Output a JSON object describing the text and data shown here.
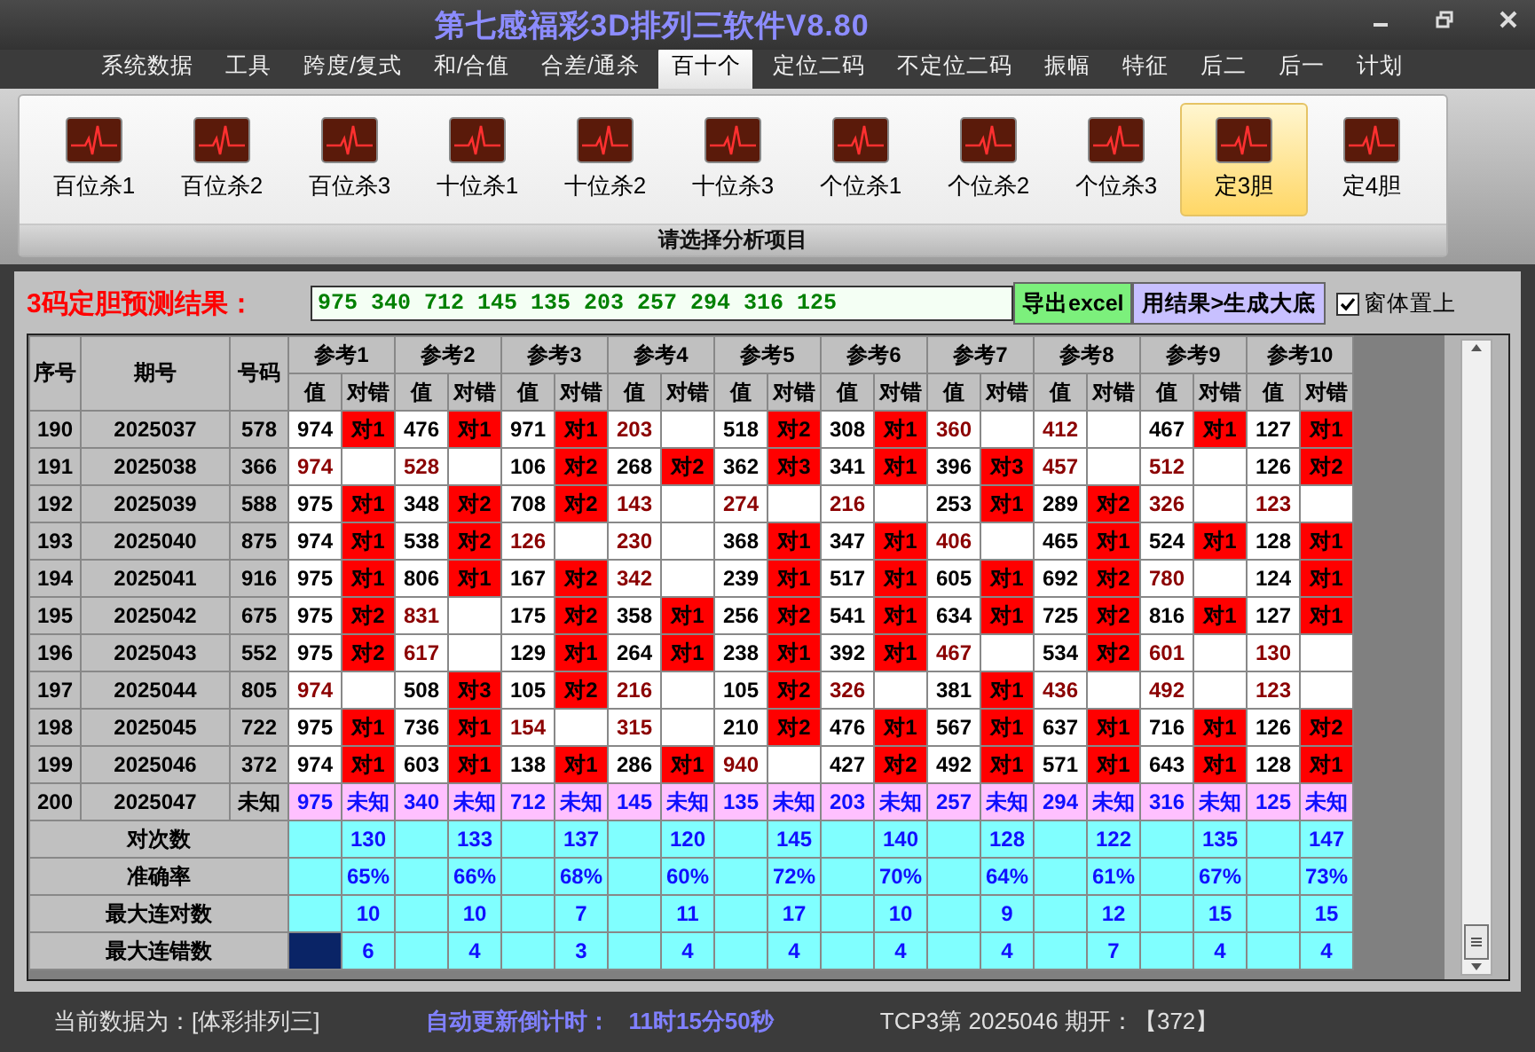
{
  "window": {
    "title": "第七感福彩3D排列三软件V8.80"
  },
  "menu": [
    {
      "label": "系统数据",
      "selected": false
    },
    {
      "label": "工具",
      "selected": false
    },
    {
      "label": "跨度/复式",
      "selected": false
    },
    {
      "label": "和/合值",
      "selected": false
    },
    {
      "label": "合差/通杀",
      "selected": false
    },
    {
      "label": "百十个",
      "selected": true
    },
    {
      "label": "定位二码",
      "selected": false
    },
    {
      "label": "不定位二码",
      "selected": false
    },
    {
      "label": "振幅",
      "selected": false
    },
    {
      "label": "特征",
      "selected": false
    },
    {
      "label": "后二",
      "selected": false
    },
    {
      "label": "后一",
      "selected": false
    },
    {
      "label": "计划",
      "selected": false
    }
  ],
  "ribbon": {
    "caption": "请选择分析项目",
    "items": [
      {
        "label": "百位杀1",
        "selected": false
      },
      {
        "label": "百位杀2",
        "selected": false
      },
      {
        "label": "百位杀3",
        "selected": false
      },
      {
        "label": "十位杀1",
        "selected": false
      },
      {
        "label": "十位杀2",
        "selected": false
      },
      {
        "label": "十位杀3",
        "selected": false
      },
      {
        "label": "个位杀1",
        "selected": false
      },
      {
        "label": "个位杀2",
        "selected": false
      },
      {
        "label": "个位杀3",
        "selected": false
      },
      {
        "label": "定3胆",
        "selected": true
      },
      {
        "label": "定4胆",
        "selected": false
      }
    ]
  },
  "prediction": {
    "label": "3码定胆预测结果：",
    "value": "975 340 712 145 135 203 257 294 316 125",
    "buttons": [
      "导出excel",
      "用结果>生成大底"
    ],
    "topmost": {
      "label": "窗体置上",
      "checked": true
    }
  },
  "table": {
    "columns": [
      "序号",
      "期号",
      "号码"
    ],
    "ref_groups": [
      {
        "label": "参考1",
        "sub_columns": [
          "值",
          "对错"
        ]
      },
      {
        "label": "参考2",
        "sub_columns": [
          "值",
          "对错"
        ]
      },
      {
        "label": "参考3",
        "sub_columns": [
          "值",
          "对错"
        ]
      },
      {
        "label": "参考4",
        "sub_columns": [
          "值",
          "对错"
        ]
      },
      {
        "label": "参考5",
        "sub_columns": [
          "值",
          "对错"
        ]
      },
      {
        "label": "参考6",
        "sub_columns": [
          "值",
          "对错"
        ]
      },
      {
        "label": "参考7",
        "sub_columns": [
          "值",
          "对错"
        ]
      },
      {
        "label": "参考8",
        "sub_columns": [
          "值",
          "对错"
        ]
      },
      {
        "label": "参考9",
        "sub_columns": [
          "值",
          "对错"
        ]
      },
      {
        "label": "参考10",
        "sub_columns": [
          "值",
          "对错"
        ]
      }
    ],
    "rows": [
      {
        "seq": "190",
        "period": "2025037",
        "number": "578",
        "kind": "history",
        "refs": [
          {
            "value": "974",
            "result": "对1"
          },
          {
            "value": "476",
            "result": "对1"
          },
          {
            "value": "971",
            "result": "对1"
          },
          {
            "value": "203"
          },
          {
            "value": "518",
            "result": "对2"
          },
          {
            "value": "308",
            "result": "对1"
          },
          {
            "value": "360"
          },
          {
            "value": "412"
          },
          {
            "value": "467",
            "result": "对1"
          },
          {
            "value": "127",
            "result": "对1"
          }
        ]
      },
      {
        "seq": "191",
        "period": "2025038",
        "number": "366",
        "kind": "history",
        "refs": [
          {
            "value": "974"
          },
          {
            "value": "528"
          },
          {
            "value": "106",
            "result": "对2"
          },
          {
            "value": "268",
            "result": "对2"
          },
          {
            "value": "362",
            "result": "对3"
          },
          {
            "value": "341",
            "result": "对1"
          },
          {
            "value": "396",
            "result": "对3"
          },
          {
            "value": "457"
          },
          {
            "value": "512"
          },
          {
            "value": "126",
            "result": "对2"
          }
        ]
      },
      {
        "seq": "192",
        "period": "2025039",
        "number": "588",
        "kind": "history",
        "refs": [
          {
            "value": "975",
            "result": "对1"
          },
          {
            "value": "348",
            "result": "对2"
          },
          {
            "value": "708",
            "result": "对2"
          },
          {
            "value": "143"
          },
          {
            "value": "274"
          },
          {
            "value": "216"
          },
          {
            "value": "253",
            "result": "对1"
          },
          {
            "value": "289",
            "result": "对2"
          },
          {
            "value": "326"
          },
          {
            "value": "123"
          }
        ]
      },
      {
        "seq": "193",
        "period": "2025040",
        "number": "875",
        "kind": "history",
        "refs": [
          {
            "value": "974",
            "result": "对1"
          },
          {
            "value": "538",
            "result": "对2"
          },
          {
            "value": "126"
          },
          {
            "value": "230"
          },
          {
            "value": "368",
            "result": "对1"
          },
          {
            "value": "347",
            "result": "对1"
          },
          {
            "value": "406"
          },
          {
            "value": "465",
            "result": "对1"
          },
          {
            "value": "524",
            "result": "对1"
          },
          {
            "value": "128",
            "result": "对1"
          }
        ]
      },
      {
        "seq": "194",
        "period": "2025041",
        "number": "916",
        "kind": "history",
        "refs": [
          {
            "value": "975",
            "result": "对1"
          },
          {
            "value": "806",
            "result": "对1"
          },
          {
            "value": "167",
            "result": "对2"
          },
          {
            "value": "342"
          },
          {
            "value": "239",
            "result": "对1"
          },
          {
            "value": "517",
            "result": "对1"
          },
          {
            "value": "605",
            "result": "对1"
          },
          {
            "value": "692",
            "result": "对2"
          },
          {
            "value": "780"
          },
          {
            "value": "124",
            "result": "对1"
          }
        ]
      },
      {
        "seq": "195",
        "period": "2025042",
        "number": "675",
        "kind": "history",
        "refs": [
          {
            "value": "975",
            "result": "对2"
          },
          {
            "value": "831"
          },
          {
            "value": "175",
            "result": "对2"
          },
          {
            "value": "358",
            "result": "对1"
          },
          {
            "value": "256",
            "result": "对2"
          },
          {
            "value": "541",
            "result": "对1"
          },
          {
            "value": "634",
            "result": "对1"
          },
          {
            "value": "725",
            "result": "对2"
          },
          {
            "value": "816",
            "result": "对1"
          },
          {
            "value": "127",
            "result": "对1"
          }
        ]
      },
      {
        "seq": "196",
        "period": "2025043",
        "number": "552",
        "kind": "history",
        "refs": [
          {
            "value": "975",
            "result": "对2"
          },
          {
            "value": "617"
          },
          {
            "value": "129",
            "result": "对1"
          },
          {
            "value": "264",
            "result": "对1"
          },
          {
            "value": "238",
            "result": "对1"
          },
          {
            "value": "392",
            "result": "对1"
          },
          {
            "value": "467"
          },
          {
            "value": "534",
            "result": "对2"
          },
          {
            "value": "601"
          },
          {
            "value": "130"
          }
        ]
      },
      {
        "seq": "197",
        "period": "2025044",
        "number": "805",
        "kind": "history",
        "refs": [
          {
            "value": "974"
          },
          {
            "value": "508",
            "result": "对3"
          },
          {
            "value": "105",
            "result": "对2"
          },
          {
            "value": "216"
          },
          {
            "value": "105",
            "result": "对2"
          },
          {
            "value": "326"
          },
          {
            "value": "381",
            "result": "对1"
          },
          {
            "value": "436"
          },
          {
            "value": "492"
          },
          {
            "value": "123"
          }
        ]
      },
      {
        "seq": "198",
        "period": "2025045",
        "number": "722",
        "kind": "history",
        "refs": [
          {
            "value": "975",
            "result": "对1"
          },
          {
            "value": "736",
            "result": "对1"
          },
          {
            "value": "154"
          },
          {
            "value": "315"
          },
          {
            "value": "210",
            "result": "对2"
          },
          {
            "value": "476",
            "result": "对1"
          },
          {
            "value": "567",
            "result": "对1"
          },
          {
            "value": "637",
            "result": "对1"
          },
          {
            "value": "716",
            "result": "对1"
          },
          {
            "value": "126",
            "result": "对2"
          }
        ]
      },
      {
        "seq": "199",
        "period": "2025046",
        "number": "372",
        "kind": "history",
        "refs": [
          {
            "value": "974",
            "result": "对1"
          },
          {
            "value": "603",
            "result": "对1"
          },
          {
            "value": "138",
            "result": "对1"
          },
          {
            "value": "286",
            "result": "对1"
          },
          {
            "value": "940"
          },
          {
            "value": "427",
            "result": "对2"
          },
          {
            "value": "492",
            "result": "对1"
          },
          {
            "value": "571",
            "result": "对1"
          },
          {
            "value": "643",
            "result": "对1"
          },
          {
            "value": "128",
            "result": "对1"
          }
        ]
      },
      {
        "seq": "200",
        "period": "2025047",
        "number": "未知",
        "kind": "pending",
        "refs": [
          {
            "value": "975",
            "result": "未知"
          },
          {
            "value": "340",
            "result": "未知"
          },
          {
            "value": "712",
            "result": "未知"
          },
          {
            "value": "145",
            "result": "未知"
          },
          {
            "value": "135",
            "result": "未知"
          },
          {
            "value": "203",
            "result": "未知"
          },
          {
            "value": "257",
            "result": "未知"
          },
          {
            "value": "294",
            "result": "未知"
          },
          {
            "value": "316",
            "result": "未知"
          },
          {
            "value": "125",
            "result": "未知"
          }
        ]
      }
    ],
    "stats": [
      {
        "label": "对次数",
        "focused": false,
        "values": [
          "130",
          "133",
          "137",
          "120",
          "145",
          "140",
          "128",
          "122",
          "135",
          "147"
        ]
      },
      {
        "label": "准确率",
        "focused": false,
        "values": [
          "65%",
          "66%",
          "68%",
          "60%",
          "72%",
          "70%",
          "64%",
          "61%",
          "67%",
          "73%"
        ]
      },
      {
        "label": "最大连对数",
        "focused": false,
        "values": [
          "10",
          "10",
          "7",
          "11",
          "17",
          "10",
          "9",
          "12",
          "15",
          "15"
        ]
      },
      {
        "label": "最大连错数",
        "focused": true,
        "values": [
          "6",
          "4",
          "3",
          "4",
          "4",
          "4",
          "4",
          "7",
          "4",
          "4"
        ]
      }
    ]
  },
  "status_bar": {
    "data_source": "当前数据为：[体彩排列三]",
    "countdown_label": "自动更新倒计时：",
    "countdown": "11时15分50秒",
    "last_draw": "TCP3第 2025046 期开：【372】"
  }
}
